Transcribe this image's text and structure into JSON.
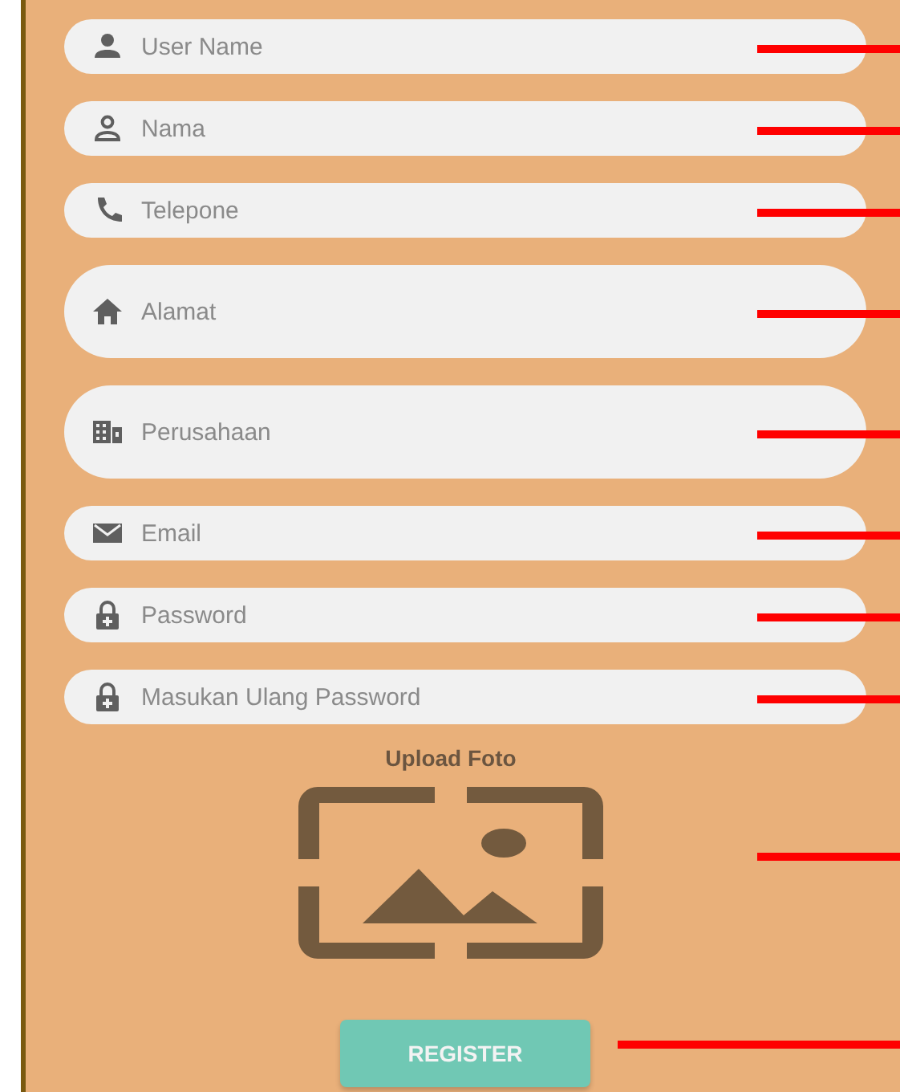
{
  "fields": [
    {
      "kind": "single",
      "placeholder": "User Name"
    },
    {
      "kind": "single",
      "placeholder": "Nama"
    },
    {
      "kind": "single",
      "placeholder": "Telepone"
    },
    {
      "kind": "multiline",
      "placeholder": "Alamat"
    },
    {
      "kind": "multiline",
      "placeholder": "Perusahaan"
    },
    {
      "kind": "single",
      "placeholder": "Email"
    },
    {
      "kind": "single",
      "placeholder": "Password"
    },
    {
      "kind": "single",
      "placeholder": "Masukan Ulang Password"
    }
  ],
  "upload": {
    "label": "Upload Foto"
  },
  "button": "REGISTER"
}
